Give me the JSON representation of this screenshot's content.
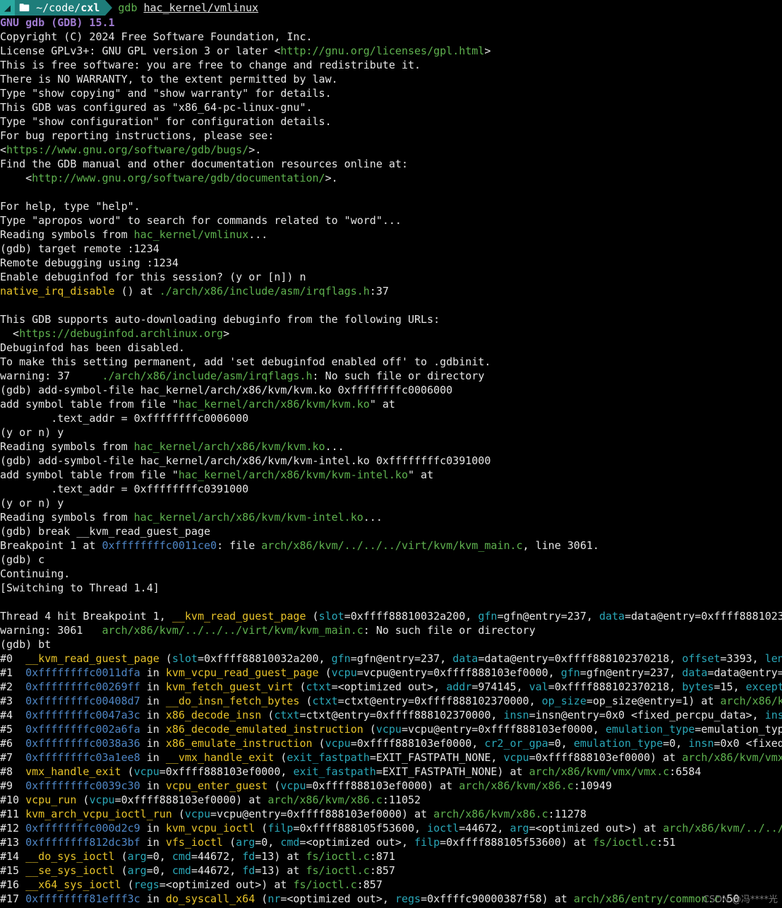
{
  "prompt": {
    "os_icon": "arch-icon",
    "segment_icon": "folder-icon",
    "path": "~/code/",
    "path_bold": "cxl",
    "command": "gdb",
    "argument": "hac_kernel/vmlinux"
  },
  "colors": {
    "background": "#000000",
    "text": "#e6e6e6",
    "function": "#e6c229",
    "path": "#5fb24f",
    "address": "#4f86c6",
    "param": "#2aa7b8",
    "banner": "#a07bd0"
  },
  "lines": [
    [
      {
        "t": "GNU gdb (GDB) 15.1",
        "c": "p"
      }
    ],
    [
      {
        "t": "Copyright (C) 2024 Free Software Foundation, Inc."
      }
    ],
    [
      {
        "t": "License GPLv3+: GNU GPL version 3 or later <"
      },
      {
        "t": "http://gnu.org/licenses/gpl.html",
        "c": "g"
      },
      {
        "t": ">"
      }
    ],
    [
      {
        "t": "This is free software: you are free to change and redistribute it."
      }
    ],
    [
      {
        "t": "There is NO WARRANTY, to the extent permitted by law."
      }
    ],
    [
      {
        "t": "Type \"show copying\" and \"show warranty\" for details."
      }
    ],
    [
      {
        "t": "This GDB was configured as \"x86_64-pc-linux-gnu\"."
      }
    ],
    [
      {
        "t": "Type \"show configuration\" for configuration details."
      }
    ],
    [
      {
        "t": "For bug reporting instructions, please see:"
      }
    ],
    [
      {
        "t": "<"
      },
      {
        "t": "https://www.gnu.org/software/gdb/bugs/",
        "c": "g"
      },
      {
        "t": ">."
      }
    ],
    [
      {
        "t": "Find the GDB manual and other documentation resources online at:"
      }
    ],
    [
      {
        "t": "    <"
      },
      {
        "t": "http://www.gnu.org/software/gdb/documentation/",
        "c": "g"
      },
      {
        "t": ">."
      }
    ],
    [
      {
        "t": ""
      }
    ],
    [
      {
        "t": "For help, type \"help\"."
      }
    ],
    [
      {
        "t": "Type \"apropos word\" to search for commands related to \"word\"..."
      }
    ],
    [
      {
        "t": "Reading symbols from "
      },
      {
        "t": "hac_kernel/vmlinux",
        "c": "g"
      },
      {
        "t": "..."
      }
    ],
    [
      {
        "t": "(gdb) target remote :1234"
      }
    ],
    [
      {
        "t": "Remote debugging using :1234"
      }
    ],
    [
      {
        "t": "Enable debuginfod for this session? (y or [n]) n"
      }
    ],
    [
      {
        "t": "native_irq_disable",
        "c": "y"
      },
      {
        "t": " () at "
      },
      {
        "t": "./arch/x86/include/asm/irqflags.h",
        "c": "g"
      },
      {
        "t": ":37"
      }
    ],
    [
      {
        "t": ""
      }
    ],
    [
      {
        "t": "This GDB supports auto-downloading debuginfo from the following URLs:"
      }
    ],
    [
      {
        "t": "  <"
      },
      {
        "t": "https://debuginfod.archlinux.org",
        "c": "g"
      },
      {
        "t": ">"
      }
    ],
    [
      {
        "t": "Debuginfod has been disabled."
      }
    ],
    [
      {
        "t": "To make this setting permanent, add 'set debuginfod enabled off' to .gdbinit."
      }
    ],
    [
      {
        "t": "warning: 37     "
      },
      {
        "t": "./arch/x86/include/asm/irqflags.h",
        "c": "g"
      },
      {
        "t": ": No such file or directory"
      }
    ],
    [
      {
        "t": "(gdb) add-symbol-file hac_kernel/arch/x86/kvm/kvm.ko 0xffffffffc0006000"
      }
    ],
    [
      {
        "t": "add symbol table from file \""
      },
      {
        "t": "hac_kernel/arch/x86/kvm/kvm.ko",
        "c": "g"
      },
      {
        "t": "\" at"
      }
    ],
    [
      {
        "t": "        .text_addr = 0xffffffffc0006000"
      }
    ],
    [
      {
        "t": "(y or n) y"
      }
    ],
    [
      {
        "t": "Reading symbols from "
      },
      {
        "t": "hac_kernel/arch/x86/kvm/kvm.ko",
        "c": "g"
      },
      {
        "t": "..."
      }
    ],
    [
      {
        "t": "(gdb) add-symbol-file hac_kernel/arch/x86/kvm/kvm-intel.ko 0xffffffffc0391000"
      }
    ],
    [
      {
        "t": "add symbol table from file \""
      },
      {
        "t": "hac_kernel/arch/x86/kvm/kvm-intel.ko",
        "c": "g"
      },
      {
        "t": "\" at"
      }
    ],
    [
      {
        "t": "        .text_addr = 0xffffffffc0391000"
      }
    ],
    [
      {
        "t": "(y or n) y"
      }
    ],
    [
      {
        "t": "Reading symbols from "
      },
      {
        "t": "hac_kernel/arch/x86/kvm/kvm-intel.ko",
        "c": "g"
      },
      {
        "t": "..."
      }
    ],
    [
      {
        "t": "(gdb) break __kvm_read_guest_page"
      }
    ],
    [
      {
        "t": "Breakpoint 1 at "
      },
      {
        "t": "0xffffffffc0011ce0",
        "c": "b"
      },
      {
        "t": ": file "
      },
      {
        "t": "arch/x86/kvm/../../../virt/kvm/kvm_main.c",
        "c": "g"
      },
      {
        "t": ", line 3061."
      }
    ],
    [
      {
        "t": "(gdb) c"
      }
    ],
    [
      {
        "t": "Continuing."
      }
    ],
    [
      {
        "t": "[Switching to Thread 1.4]"
      }
    ],
    [
      {
        "t": ""
      }
    ],
    [
      {
        "t": "Thread 4 hit Breakpoint 1, "
      },
      {
        "t": "__kvm_read_guest_page",
        "c": "y"
      },
      {
        "t": " ("
      },
      {
        "t": "slot",
        "c": "c"
      },
      {
        "t": "=0xffff88810032a200, "
      },
      {
        "t": "gfn",
        "c": "c"
      },
      {
        "t": "=gfn@entry=237, "
      },
      {
        "t": "data",
        "c": "c"
      },
      {
        "t": "=data@entry=0xffff8881023"
      }
    ],
    [
      {
        "t": "warning: 3061   "
      },
      {
        "t": "arch/x86/kvm/../../../virt/kvm/kvm_main.c",
        "c": "g"
      },
      {
        "t": ": No such file or directory"
      }
    ],
    [
      {
        "t": "(gdb) bt"
      }
    ],
    [
      {
        "t": "#0  "
      },
      {
        "t": "__kvm_read_guest_page",
        "c": "y"
      },
      {
        "t": " ("
      },
      {
        "t": "slot",
        "c": "c"
      },
      {
        "t": "=0xffff88810032a200, "
      },
      {
        "t": "gfn",
        "c": "c"
      },
      {
        "t": "=gfn@entry=237, "
      },
      {
        "t": "data",
        "c": "c"
      },
      {
        "t": "=data@entry=0xffff888102370218, "
      },
      {
        "t": "offset",
        "c": "c"
      },
      {
        "t": "=3393, "
      },
      {
        "t": "len",
        "c": "c"
      }
    ],
    [
      {
        "t": "#1  "
      },
      {
        "t": "0xffffffffc0011dfa",
        "c": "b"
      },
      {
        "t": " in "
      },
      {
        "t": "kvm_vcpu_read_guest_page",
        "c": "y"
      },
      {
        "t": " ("
      },
      {
        "t": "vcpu",
        "c": "c"
      },
      {
        "t": "=vcpu@entry=0xffff888103ef0000, "
      },
      {
        "t": "gfn",
        "c": "c"
      },
      {
        "t": "=gfn@entry=237, "
      },
      {
        "t": "data",
        "c": "c"
      },
      {
        "t": "=data@entry="
      }
    ],
    [
      {
        "t": "#2  "
      },
      {
        "t": "0xffffffffc00269ff",
        "c": "b"
      },
      {
        "t": " in "
      },
      {
        "t": "kvm_fetch_guest_virt",
        "c": "y"
      },
      {
        "t": " ("
      },
      {
        "t": "ctxt",
        "c": "c"
      },
      {
        "t": "=<optimized out>, "
      },
      {
        "t": "addr",
        "c": "c"
      },
      {
        "t": "=974145, "
      },
      {
        "t": "val",
        "c": "c"
      },
      {
        "t": "=0xffff888102370218, "
      },
      {
        "t": "bytes",
        "c": "c"
      },
      {
        "t": "=15, "
      },
      {
        "t": "except",
        "c": "c"
      }
    ],
    [
      {
        "t": "#3  "
      },
      {
        "t": "0xffffffffc00408d7",
        "c": "b"
      },
      {
        "t": " in "
      },
      {
        "t": "__do_insn_fetch_bytes",
        "c": "y"
      },
      {
        "t": " ("
      },
      {
        "t": "ctxt",
        "c": "c"
      },
      {
        "t": "=ctxt@entry=0xffff888102370000, "
      },
      {
        "t": "op_size",
        "c": "c"
      },
      {
        "t": "=op_size@entry=1) at "
      },
      {
        "t": "arch/x86/k",
        "c": "g"
      }
    ],
    [
      {
        "t": "#4  "
      },
      {
        "t": "0xffffffffc0047a3c",
        "c": "b"
      },
      {
        "t": " in "
      },
      {
        "t": "x86_decode_insn",
        "c": "y"
      },
      {
        "t": " ("
      },
      {
        "t": "ctxt",
        "c": "c"
      },
      {
        "t": "=ctxt@entry=0xffff888102370000, "
      },
      {
        "t": "insn",
        "c": "c"
      },
      {
        "t": "=insn@entry=0x0 <fixed_percpu_data>, "
      },
      {
        "t": "ins",
        "c": "c"
      }
    ],
    [
      {
        "t": "#5  "
      },
      {
        "t": "0xffffffffc002a6fa",
        "c": "b"
      },
      {
        "t": " in "
      },
      {
        "t": "x86_decode_emulated_instruction",
        "c": "y"
      },
      {
        "t": " ("
      },
      {
        "t": "vcpu",
        "c": "c"
      },
      {
        "t": "=vcpu@entry=0xffff888103ef0000, "
      },
      {
        "t": "emulation_type",
        "c": "c"
      },
      {
        "t": "=emulation_typ"
      }
    ],
    [
      {
        "t": "#6  "
      },
      {
        "t": "0xffffffffc0038a36",
        "c": "b"
      },
      {
        "t": " in "
      },
      {
        "t": "x86_emulate_instruction",
        "c": "y"
      },
      {
        "t": " ("
      },
      {
        "t": "vcpu",
        "c": "c"
      },
      {
        "t": "=0xffff888103ef0000, "
      },
      {
        "t": "cr2_or_gpa",
        "c": "c"
      },
      {
        "t": "=0, "
      },
      {
        "t": "emulation_type",
        "c": "c"
      },
      {
        "t": "=0, "
      },
      {
        "t": "insn",
        "c": "c"
      },
      {
        "t": "=0x0 <fixed"
      }
    ],
    [
      {
        "t": "#7  "
      },
      {
        "t": "0xffffffffc03a1ee8",
        "c": "b"
      },
      {
        "t": " in "
      },
      {
        "t": "__vmx_handle_exit",
        "c": "y"
      },
      {
        "t": " ("
      },
      {
        "t": "exit_fastpath",
        "c": "c"
      },
      {
        "t": "=EXIT_FASTPATH_NONE, "
      },
      {
        "t": "vcpu",
        "c": "c"
      },
      {
        "t": "=0xffff888103ef0000) at "
      },
      {
        "t": "arch/x86/kvm/vmx",
        "c": "g"
      }
    ],
    [
      {
        "t": "#8  "
      },
      {
        "t": "vmx_handle_exit",
        "c": "y"
      },
      {
        "t": " ("
      },
      {
        "t": "vcpu",
        "c": "c"
      },
      {
        "t": "=0xffff888103ef0000, "
      },
      {
        "t": "exit_fastpath",
        "c": "c"
      },
      {
        "t": "=EXIT_FASTPATH_NONE) at "
      },
      {
        "t": "arch/x86/kvm/vmx/vmx.c",
        "c": "g"
      },
      {
        "t": ":6584"
      }
    ],
    [
      {
        "t": "#9  "
      },
      {
        "t": "0xffffffffc0039c30",
        "c": "b"
      },
      {
        "t": " in "
      },
      {
        "t": "vcpu_enter_guest",
        "c": "y"
      },
      {
        "t": " ("
      },
      {
        "t": "vcpu",
        "c": "c"
      },
      {
        "t": "=0xffff888103ef0000) at "
      },
      {
        "t": "arch/x86/kvm/x86.c",
        "c": "g"
      },
      {
        "t": ":10949"
      }
    ],
    [
      {
        "t": "#10 "
      },
      {
        "t": "vcpu_run",
        "c": "y"
      },
      {
        "t": " ("
      },
      {
        "t": "vcpu",
        "c": "c"
      },
      {
        "t": "=0xffff888103ef0000) at "
      },
      {
        "t": "arch/x86/kvm/x86.c",
        "c": "g"
      },
      {
        "t": ":11052"
      }
    ],
    [
      {
        "t": "#11 "
      },
      {
        "t": "kvm_arch_vcpu_ioctl_run",
        "c": "y"
      },
      {
        "t": " ("
      },
      {
        "t": "vcpu",
        "c": "c"
      },
      {
        "t": "=vcpu@entry=0xffff888103ef0000) at "
      },
      {
        "t": "arch/x86/kvm/x86.c",
        "c": "g"
      },
      {
        "t": ":11278"
      }
    ],
    [
      {
        "t": "#12 "
      },
      {
        "t": "0xffffffffc000d2c9",
        "c": "b"
      },
      {
        "t": " in "
      },
      {
        "t": "kvm_vcpu_ioctl",
        "c": "y"
      },
      {
        "t": " ("
      },
      {
        "t": "filp",
        "c": "c"
      },
      {
        "t": "=0xffff888105f53600, "
      },
      {
        "t": "ioctl",
        "c": "c"
      },
      {
        "t": "=44672, "
      },
      {
        "t": "arg",
        "c": "c"
      },
      {
        "t": "=<optimized out>) at "
      },
      {
        "t": "arch/x86/kvm/../../",
        "c": "g"
      }
    ],
    [
      {
        "t": "#13 "
      },
      {
        "t": "0xffffffff812dc3bf",
        "c": "b"
      },
      {
        "t": " in "
      },
      {
        "t": "vfs_ioctl",
        "c": "y"
      },
      {
        "t": " ("
      },
      {
        "t": "arg",
        "c": "c"
      },
      {
        "t": "=0, "
      },
      {
        "t": "cmd",
        "c": "c"
      },
      {
        "t": "=<optimized out>, "
      },
      {
        "t": "filp",
        "c": "c"
      },
      {
        "t": "=0xffff888105f53600) at "
      },
      {
        "t": "fs/ioctl.c",
        "c": "g"
      },
      {
        "t": ":51"
      }
    ],
    [
      {
        "t": "#14 "
      },
      {
        "t": "__do_sys_ioctl",
        "c": "y"
      },
      {
        "t": " ("
      },
      {
        "t": "arg",
        "c": "c"
      },
      {
        "t": "=0, "
      },
      {
        "t": "cmd",
        "c": "c"
      },
      {
        "t": "=44672, "
      },
      {
        "t": "fd",
        "c": "c"
      },
      {
        "t": "=13) at "
      },
      {
        "t": "fs/ioctl.c",
        "c": "g"
      },
      {
        "t": ":871"
      }
    ],
    [
      {
        "t": "#15 "
      },
      {
        "t": "__se_sys_ioctl",
        "c": "y"
      },
      {
        "t": " ("
      },
      {
        "t": "arg",
        "c": "c"
      },
      {
        "t": "=0, "
      },
      {
        "t": "cmd",
        "c": "c"
      },
      {
        "t": "=44672, "
      },
      {
        "t": "fd",
        "c": "c"
      },
      {
        "t": "=13) at "
      },
      {
        "t": "fs/ioctl.c",
        "c": "g"
      },
      {
        "t": ":857"
      }
    ],
    [
      {
        "t": "#16 "
      },
      {
        "t": "__x64_sys_ioctl",
        "c": "y"
      },
      {
        "t": " ("
      },
      {
        "t": "regs",
        "c": "c"
      },
      {
        "t": "=<optimized out>) at "
      },
      {
        "t": "fs/ioctl.c",
        "c": "g"
      },
      {
        "t": ":857"
      }
    ],
    [
      {
        "t": "#17 "
      },
      {
        "t": "0xffffffff81efff3c",
        "c": "b"
      },
      {
        "t": " in "
      },
      {
        "t": "do_syscall_x64",
        "c": "y"
      },
      {
        "t": " ("
      },
      {
        "t": "nr",
        "c": "c"
      },
      {
        "t": "=<optimized out>, "
      },
      {
        "t": "regs",
        "c": "c"
      },
      {
        "t": "=0xffffc90000387f58) at "
      },
      {
        "t": "arch/x86/entry/common.c",
        "c": "g"
      },
      {
        "t": ":50"
      }
    ]
  ],
  "watermark": "CSDN @冯****光"
}
